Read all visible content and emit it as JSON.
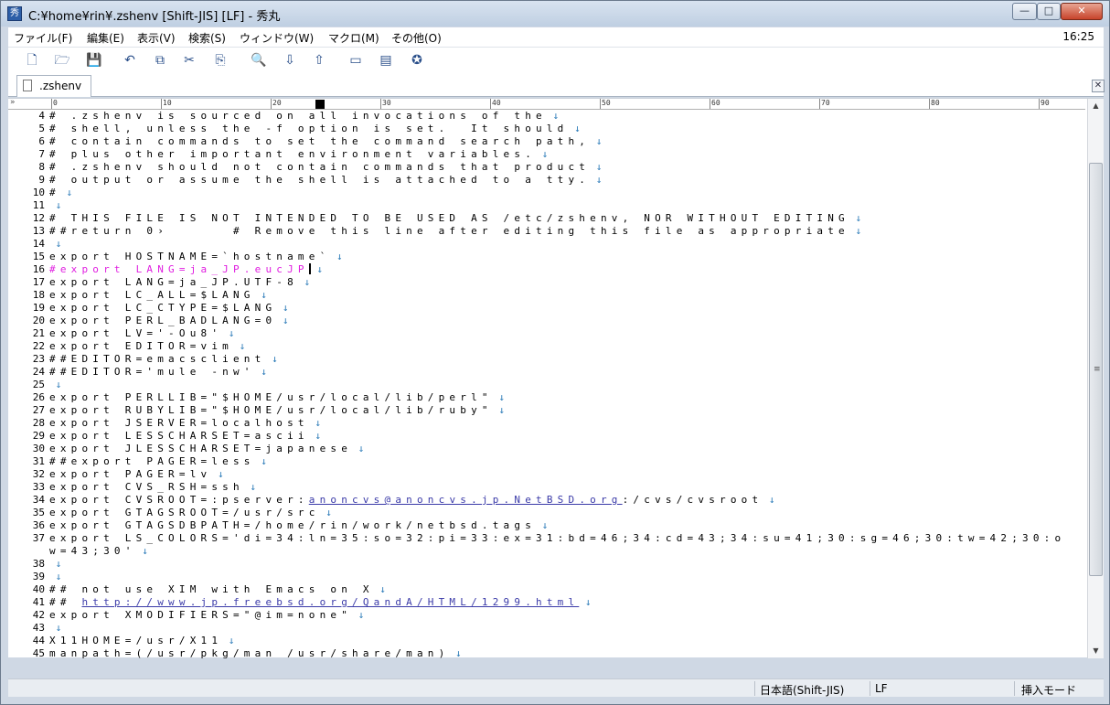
{
  "window": {
    "title": "C:¥home¥rin¥.zshenv  [Shift-JIS] [LF] - 秀丸",
    "app_icon_glyph": "秀"
  },
  "window_buttons": {
    "minimize": "—",
    "maximize": "□",
    "close": "✕"
  },
  "menu": {
    "items": [
      "ファイル(F)",
      "編集(E)",
      "表示(V)",
      "検索(S)",
      "ウィンドウ(W)",
      "マクロ(M)",
      "その他(O)"
    ],
    "clock": "16:25"
  },
  "toolbar": {
    "icons": [
      "new-file-icon",
      "open-folder-icon",
      "save-icon",
      "undo-icon",
      "copy-icon",
      "cut-icon",
      "paste-icon",
      "search-icon",
      "find-down-icon",
      "find-up-icon",
      "grep-icon",
      "split-window-icon",
      "help-icon"
    ],
    "glyphs": [
      "🗋",
      "🗁",
      "💾",
      "↶",
      "⧉",
      "✂",
      "⎘",
      "🔍",
      "⇩",
      "⇧",
      "▭",
      "▤",
      "✪"
    ]
  },
  "tab": {
    "label": ".zshenv",
    "close": "✕"
  },
  "ruler": {
    "numbers": [
      "0",
      "10",
      "20",
      "30",
      "40",
      "50",
      "60",
      "70",
      "80",
      "90"
    ],
    "chevron": "»"
  },
  "editor": {
    "lines": [
      {
        "n": "4",
        "text": "# .zshenv is sourced on all invocations of the",
        "eol": "↓"
      },
      {
        "n": "5",
        "text": "# shell, unless the -f option is set.  It should",
        "eol": "↓"
      },
      {
        "n": "6",
        "text": "# contain commands to set the command search path,",
        "eol": "↓"
      },
      {
        "n": "7",
        "text": "# plus other important environment variables.",
        "eol": "↓"
      },
      {
        "n": "8",
        "text": "# .zshenv should not contain commands that product",
        "eol": "↓"
      },
      {
        "n": "9",
        "text": "# output or assume the shell is attached to a tty.",
        "eol": "↓"
      },
      {
        "n": "10",
        "text": "#",
        "eol": "↓"
      },
      {
        "n": "11",
        "text": "",
        "eol": "↓"
      },
      {
        "n": "12",
        "text": "# THIS FILE IS NOT INTENDED TO BE USED AS /etc/zshenv, NOR WITHOUT EDITING",
        "eol": "↓"
      },
      {
        "n": "13",
        "text": "##return 0›      # Remove this line after editing this file as appropriate",
        "eol": "↓"
      },
      {
        "n": "14",
        "text": "",
        "eol": "↓"
      },
      {
        "n": "15",
        "text": "export HOSTNAME=`hostname`",
        "eol": "↓"
      },
      {
        "n": "16",
        "text": "#export LANG=ja_JP.eucJP",
        "eol": "↓"
      },
      {
        "n": "17",
        "text": "export LANG=ja_JP.UTF-8",
        "eol": "↓"
      },
      {
        "n": "18",
        "text": "export LC_ALL=$LANG",
        "eol": "↓"
      },
      {
        "n": "19",
        "text": "export LC_CTYPE=$LANG",
        "eol": "↓"
      },
      {
        "n": "20",
        "text": "export PERL_BADLANG=0",
        "eol": "↓"
      },
      {
        "n": "21",
        "text": "export LV='-Ou8'",
        "eol": "↓"
      },
      {
        "n": "22",
        "text": "export EDITOR=vim",
        "eol": "↓"
      },
      {
        "n": "23",
        "text": "##EDITOR=emacsclient",
        "eol": "↓"
      },
      {
        "n": "24",
        "text": "##EDITOR='mule -nw'",
        "eol": "↓"
      },
      {
        "n": "25",
        "text": "",
        "eol": "↓"
      },
      {
        "n": "26",
        "text": "export PERLLIB=\"$HOME/usr/local/lib/perl\"",
        "eol": "↓"
      },
      {
        "n": "27",
        "text": "export RUBYLIB=\"$HOME/usr/local/lib/ruby\"",
        "eol": "↓"
      },
      {
        "n": "28",
        "text": "export JSERVER=localhost",
        "eol": "↓"
      },
      {
        "n": "29",
        "text": "export LESSCHARSET=ascii",
        "eol": "↓"
      },
      {
        "n": "30",
        "text": "export JLESSCHARSET=japanese",
        "eol": "↓"
      },
      {
        "n": "31",
        "text": "##export PAGER=less",
        "eol": "↓"
      },
      {
        "n": "32",
        "text": "export PAGER=lv",
        "eol": "↓"
      },
      {
        "n": "33",
        "text": "export CVS_RSH=ssh",
        "eol": "↓"
      },
      {
        "n": "34",
        "text": "export CVSROOT=:pserver:",
        "link": "anoncvs@anoncvs.jp.NetBSD.org",
        "after": ":/cvs/cvsroot",
        "eol": "↓"
      },
      {
        "n": "35",
        "text": "export GTAGSROOT=/usr/src",
        "eol": "↓"
      },
      {
        "n": "36",
        "text": "export GTAGSDBPATH=/home/rin/work/netbsd.tags",
        "eol": "↓"
      },
      {
        "n": "37",
        "text": "export LS_COLORS='di=34:ln=35:so=32:pi=33:ex=31:bd=46;34:cd=43;34:su=41;30:sg=46;30:tw=42;30:o",
        "eol": ""
      },
      {
        "n": "",
        "text": "w=43;30'",
        "eol": "↓"
      },
      {
        "n": "38",
        "text": "",
        "eol": "↓"
      },
      {
        "n": "39",
        "text": "",
        "eol": "↓"
      },
      {
        "n": "40",
        "text": "## not use XIM with Emacs on X",
        "eol": "↓"
      },
      {
        "n": "41",
        "text": "## ",
        "link": "http://www.jp.freebsd.org/QandA/HTML/1299.html",
        "after": "",
        "eol": "↓"
      },
      {
        "n": "42",
        "text": "export XMODIFIERS=\"@im=none\"",
        "eol": "↓"
      },
      {
        "n": "43",
        "text": "",
        "eol": "↓"
      },
      {
        "n": "44",
        "text": "X11HOME=/usr/X11",
        "eol": "↓"
      },
      {
        "n": "45",
        "text": "manpath=(/usr/pkg/man /usr/share/man)",
        "eol": "↓"
      }
    ],
    "highlight_line": "16"
  },
  "status": {
    "encoding": "日本語(Shift-JIS)",
    "newline": "LF",
    "mode": "挿入モード"
  },
  "colors": {
    "comment_magenta": "#e01ee0",
    "link": "#3a3aa8",
    "eol": "#2a7ab8"
  }
}
